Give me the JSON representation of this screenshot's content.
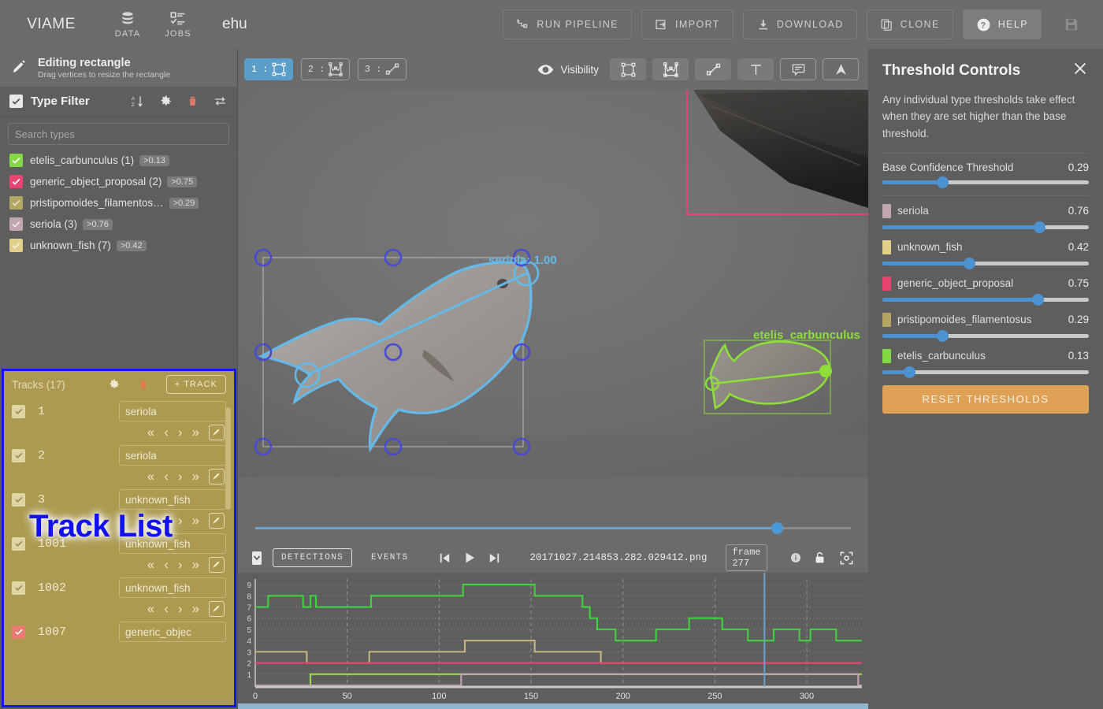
{
  "topbar": {
    "brand": "VIAME",
    "nav": [
      {
        "label": "DATA",
        "icon": "database-icon"
      },
      {
        "label": "JOBS",
        "icon": "tasklist-icon"
      }
    ],
    "project_name": "ehu",
    "actions": [
      {
        "label": "RUN PIPELINE",
        "icon": "pipeline-icon",
        "style": "outline"
      },
      {
        "label": "IMPORT",
        "icon": "import-icon",
        "style": "outline"
      },
      {
        "label": "DOWNLOAD",
        "icon": "download-icon",
        "style": "outline"
      },
      {
        "label": "CLONE",
        "icon": "clone-icon",
        "style": "outline"
      },
      {
        "label": "HELP",
        "icon": "help-icon",
        "style": "solid"
      },
      {
        "label": "",
        "icon": "save-icon",
        "style": "plain"
      }
    ]
  },
  "sidebar": {
    "editing": {
      "icon": "pencil-icon",
      "title": "Editing rectangle",
      "subtitle": "Drag vertices to resize the rectangle"
    },
    "type_filter": {
      "title": "Type Filter",
      "sort_icon": "sort-alpha-icon",
      "settings_icon": "gear-icon",
      "delete_icon": "trash-icon",
      "swap_icon": "swap-icon",
      "search_placeholder": "Search types",
      "search_value": "",
      "types": [
        {
          "name": "etelis_carbunculus (1)",
          "threshold": ">0.13",
          "color": "#84d843",
          "checked": true
        },
        {
          "name": "generic_object_proposal (2)",
          "threshold": ">0.75",
          "color": "#e94471",
          "checked": true
        },
        {
          "name": "pristipomoides_filamentos…",
          "threshold": ">0.29",
          "color": "#b3a564",
          "checked": true
        },
        {
          "name": "seriola (3)",
          "threshold": ">0.76",
          "color": "#c0a6ad",
          "checked": true
        },
        {
          "name": "unknown_fish (7)",
          "threshold": ">0.42",
          "color": "#e0d08a",
          "checked": true
        }
      ]
    }
  },
  "track_list": {
    "overlay_label": "Track List",
    "header": "Tracks (17)",
    "settings_icon": "gear-icon",
    "delete_icon": "trash-icon",
    "add_label": "TRACK",
    "add_icon": "plus-icon",
    "nav_icons": [
      "first-icon",
      "prev-icon",
      "next-icon",
      "last-icon",
      "edit-icon"
    ],
    "tracks": [
      {
        "id": "1",
        "type": "seriola",
        "checked": true,
        "cb_color": "#e2d5a4"
      },
      {
        "id": "2",
        "type": "seriola",
        "checked": true,
        "cb_color": "#e2d5a4"
      },
      {
        "id": "3",
        "type": "unknown_fish",
        "checked": true,
        "cb_color": "#e2d5a4"
      },
      {
        "id": "1001",
        "type": "unknown_fish",
        "checked": true,
        "cb_color": "#e2d5a4"
      },
      {
        "id": "1002",
        "type": "unknown_fish",
        "checked": true,
        "cb_color": "#e2d5a4"
      },
      {
        "id": "1007",
        "type": "generic_objec",
        "checked": true,
        "cb_color": "#ec7b72"
      }
    ]
  },
  "viewer": {
    "modes": [
      {
        "label": "1 :",
        "icon": "rectangle-icon",
        "active": true
      },
      {
        "label": "2 :",
        "icon": "polygon-icon",
        "active": false
      },
      {
        "label": "3 :",
        "icon": "line-icon",
        "active": false
      }
    ],
    "visibility_label": "Visibility",
    "visibility_icon": "eye-icon",
    "visibility_buttons": [
      {
        "icon": "rectangle-icon",
        "active": true
      },
      {
        "icon": "polygon-icon",
        "active": true
      },
      {
        "icon": "line-icon",
        "active": true
      },
      {
        "icon": "text-icon",
        "active": true
      },
      {
        "icon": "tooltip-icon",
        "active": false
      },
      {
        "icon": "marker-icon",
        "active": false
      }
    ],
    "annotations": [
      {
        "label": "seriola: 1.00",
        "color": "#64b9e8",
        "type": "selected-rectangle"
      },
      {
        "label": "etelis_carbunculus",
        "color": "#8ede3a",
        "type": "polygon"
      },
      {
        "label": "",
        "color": "#e9437a",
        "type": "rectangle"
      }
    ]
  },
  "playback": {
    "detections_label": "DETECTIONS",
    "events_label": "EVENTS",
    "transport": [
      "skip-prev-icon",
      "play-icon",
      "skip-next-icon"
    ],
    "filename": "20171027.214853.282.029412.png",
    "frame_label": "frame 277",
    "info_icon": "info-icon",
    "lock_icon": "lock-icon",
    "fullscreen_icon": "fit-icon",
    "seek_percent": 87
  },
  "threshold_panel": {
    "title": "Threshold Controls",
    "close_icon": "close-icon",
    "description": "Any individual type thresholds take effect when they are set higher than the base threshold.",
    "base": {
      "label": "Base Confidence Threshold",
      "value": "0.29",
      "percent": 29
    },
    "types": [
      {
        "label": "seriola",
        "value": "0.76",
        "percent": 76,
        "color": "#c0a6ad"
      },
      {
        "label": "unknown_fish",
        "value": "0.42",
        "percent": 42,
        "color": "#e0d08a"
      },
      {
        "label": "generic_object_proposal",
        "value": "0.75",
        "percent": 75,
        "color": "#e94471"
      },
      {
        "label": "pristipomoides_filamentosus",
        "value": "0.29",
        "percent": 29,
        "color": "#b3a564"
      },
      {
        "label": "etelis_carbunculus",
        "value": "0.13",
        "percent": 13,
        "color": "#84d843"
      }
    ],
    "reset_label": "RESET THRESHOLDS"
  },
  "chart_data": {
    "type": "line",
    "title": "",
    "xlabel": "",
    "ylabel": "",
    "xlim": [
      0,
      330
    ],
    "ylim": [
      0,
      9.5
    ],
    "xticks": [
      0,
      50,
      100,
      150,
      200,
      250,
      300
    ],
    "yticks": [
      1,
      2,
      3,
      4,
      5,
      6,
      7,
      8,
      9
    ],
    "grid": true,
    "playhead_frame": 277,
    "series": [
      {
        "name": "unknown_fish",
        "color": "#3fd23f",
        "steps": [
          [
            0,
            7
          ],
          [
            7,
            8
          ],
          [
            26,
            7
          ],
          [
            30,
            8
          ],
          [
            33,
            7
          ],
          [
            63,
            8
          ],
          [
            110,
            8
          ],
          [
            113,
            9
          ],
          [
            150,
            9
          ],
          [
            152,
            8
          ],
          [
            176,
            8
          ],
          [
            178,
            7
          ],
          [
            182,
            6
          ],
          [
            186,
            5
          ],
          [
            196,
            4
          ],
          [
            218,
            5
          ],
          [
            236,
            6
          ],
          [
            252,
            6
          ],
          [
            254,
            5
          ],
          [
            268,
            4
          ],
          [
            282,
            5
          ],
          [
            296,
            4
          ],
          [
            302,
            5
          ],
          [
            316,
            4
          ],
          [
            328,
            4
          ]
        ]
      },
      {
        "name": "pristipomoides_filamentosus",
        "color": "#c6b683",
        "steps": [
          [
            0,
            3
          ],
          [
            26,
            3
          ],
          [
            28,
            2
          ],
          [
            62,
            3
          ],
          [
            112,
            3
          ],
          [
            114,
            4
          ],
          [
            150,
            4
          ],
          [
            152,
            3
          ],
          [
            186,
            3
          ],
          [
            188,
            2
          ],
          [
            328,
            2
          ]
        ]
      },
      {
        "name": "generic_object_proposal",
        "color": "#e94471",
        "steps": [
          [
            0,
            2
          ],
          [
            328,
            2
          ]
        ]
      },
      {
        "name": "etelis_carbunculus",
        "color": "#9cd84a",
        "steps": [
          [
            0,
            0
          ],
          [
            8,
            0
          ],
          [
            30,
            1
          ],
          [
            328,
            1
          ]
        ]
      },
      {
        "name": "seriola",
        "color": "#c0a6ad",
        "steps": [
          [
            0,
            0
          ],
          [
            110,
            0
          ],
          [
            112,
            1
          ],
          [
            240,
            1
          ],
          [
            328,
            0
          ]
        ]
      }
    ]
  }
}
